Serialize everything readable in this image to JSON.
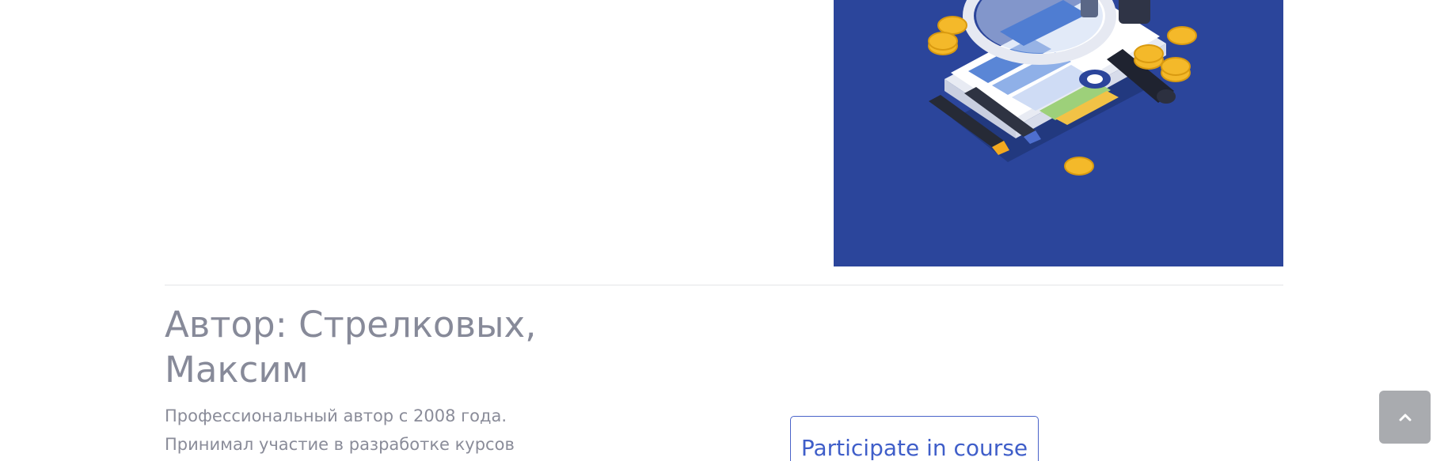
{
  "hero": {
    "background_color": "#2b459b",
    "illustration": "analytics-report-magnifier-illustration"
  },
  "author": {
    "title": "Автор: Стрелковых, Максим",
    "bio_lines": [
      "Профессиональный автор с 2008 года.",
      "Принимал участие в разработке курсов"
    ]
  },
  "actions": {
    "participate_label": "Participate in course"
  },
  "scroll_top": {
    "icon": "chevron-up-icon",
    "color": "#a9abaf"
  }
}
